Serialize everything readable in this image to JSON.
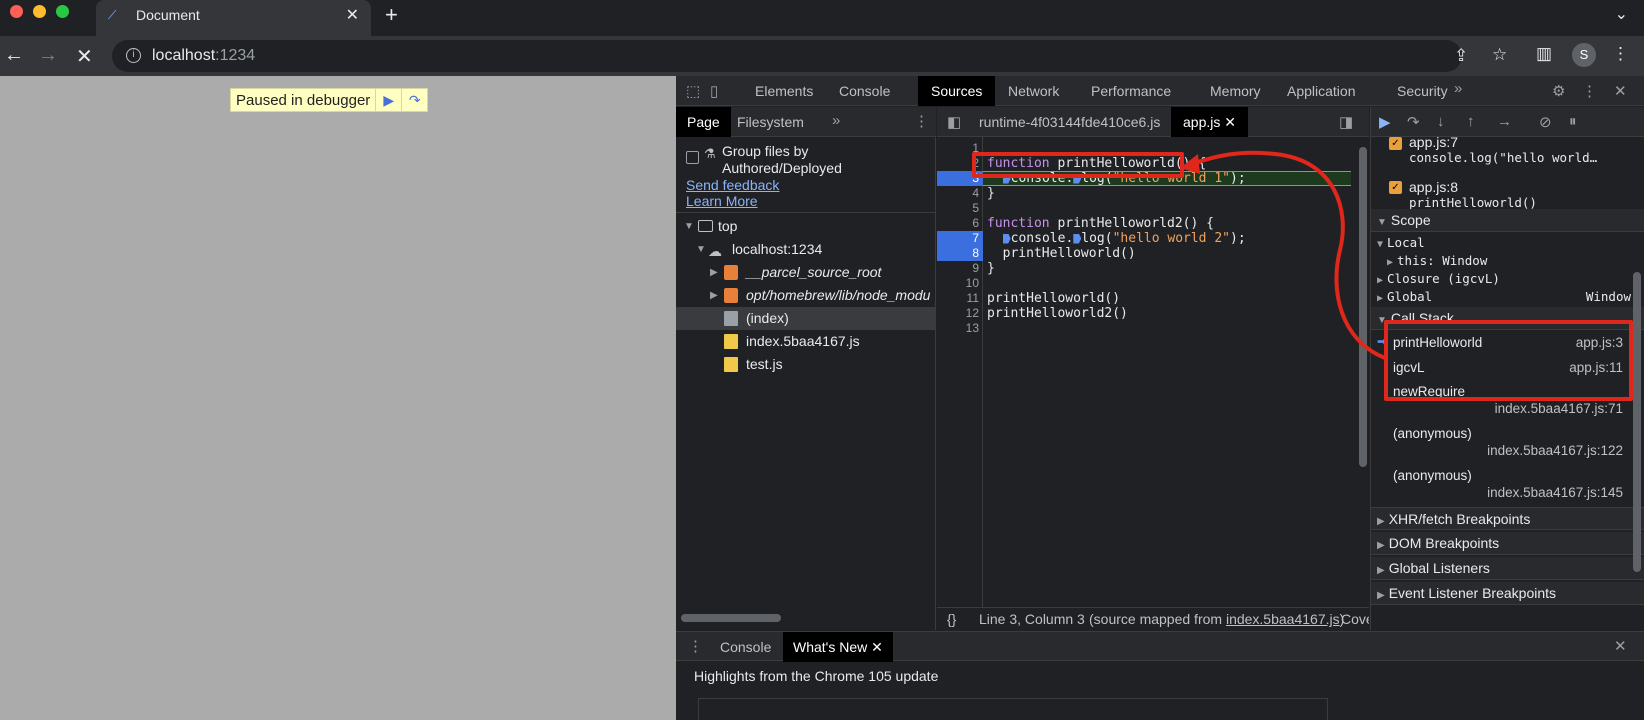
{
  "browser": {
    "tab_title": "Document",
    "url_host": "localhost",
    "url_port": ":1234"
  },
  "page": {
    "paused_label": "Paused in debugger"
  },
  "devtools": {
    "tabs": [
      "Elements",
      "Console",
      "Sources",
      "Network",
      "Performance",
      "Memory",
      "Application",
      "Security"
    ],
    "active_tab": "Sources",
    "navigator": {
      "tabs": [
        "Page",
        "Filesystem"
      ],
      "group_label_line1": "Group files by",
      "group_label_line2": "Authored/Deployed",
      "send_feedback": "Send feedback",
      "learn_more": "Learn More",
      "tree": [
        {
          "label": "top"
        },
        {
          "label": "localhost:1234"
        },
        {
          "label": "__parcel_source_root"
        },
        {
          "label": "opt/homebrew/lib/node_modu"
        },
        {
          "label": "(index)"
        },
        {
          "label": "index.5baa4167.js"
        },
        {
          "label": "test.js"
        }
      ]
    },
    "editor": {
      "tabs": [
        "runtime-4f03144fde410ce6.js",
        "app.js"
      ],
      "line_numbers": [
        "1",
        "2",
        "3",
        "4",
        "5",
        "6",
        "7",
        "8",
        "9",
        "10",
        "11",
        "12",
        "13"
      ],
      "code": {
        "l2_kw": "function",
        "l2_rest": " printHelloworld() {",
        "l3_pre": "  ",
        "l3_a": "console.",
        "l3_b": "log(",
        "l3_str": "\"hello world 1\"",
        "l3_end": ");",
        "l4": "}",
        "l6_kw": "function",
        "l6_rest": " printHelloworld2() {",
        "l7_a": "console.",
        "l7_b": "log(",
        "l7_str": "\"hello world 2\"",
        "l7_end": ");",
        "l8": "  printHelloworld()",
        "l9": "}",
        "l11": "printHelloworld()",
        "l12": "printHelloworld2()"
      },
      "status_braces": "{}",
      "status_position": "Line 3, Column 3",
      "status_source_pre": "(source mapped from ",
      "status_source_link": "index.5baa4167.js",
      "status_source_post": ")",
      "status_coverage": "Cove"
    },
    "debugger": {
      "breakpoints": [
        {
          "file": "app.js:7",
          "code": "console.log(\"hello world…"
        },
        {
          "file": "app.js:8",
          "code": "printHelloworld()"
        }
      ],
      "scope_label": "Scope",
      "local_label": "Local",
      "this_label": "this",
      "this_value": ": Window",
      "closure_label": "Closure (igcvL)",
      "global_label": "Global",
      "global_value": "Window",
      "call_stack_label": "Call Stack",
      "call_stack": [
        {
          "fn": "printHelloworld",
          "loc": "app.js:3"
        },
        {
          "fn": "igcvL",
          "loc": "app.js:11"
        },
        {
          "fn": "newRequire",
          "loc": "index.5baa4167.js:71"
        },
        {
          "fn": "(anonymous)",
          "loc": "index.5baa4167.js:122"
        },
        {
          "fn": "(anonymous)",
          "loc": "index.5baa4167.js:145"
        }
      ],
      "sections": [
        "XHR/fetch Breakpoints",
        "DOM Breakpoints",
        "Global Listeners",
        "Event Listener Breakpoints"
      ]
    },
    "drawer": {
      "tabs": [
        "Console",
        "What's New"
      ],
      "highlight": "Highlights from the Chrome 105 update"
    }
  },
  "colors": {
    "annotation": "#e0271c",
    "breakpoint": "#3b6fe0"
  }
}
